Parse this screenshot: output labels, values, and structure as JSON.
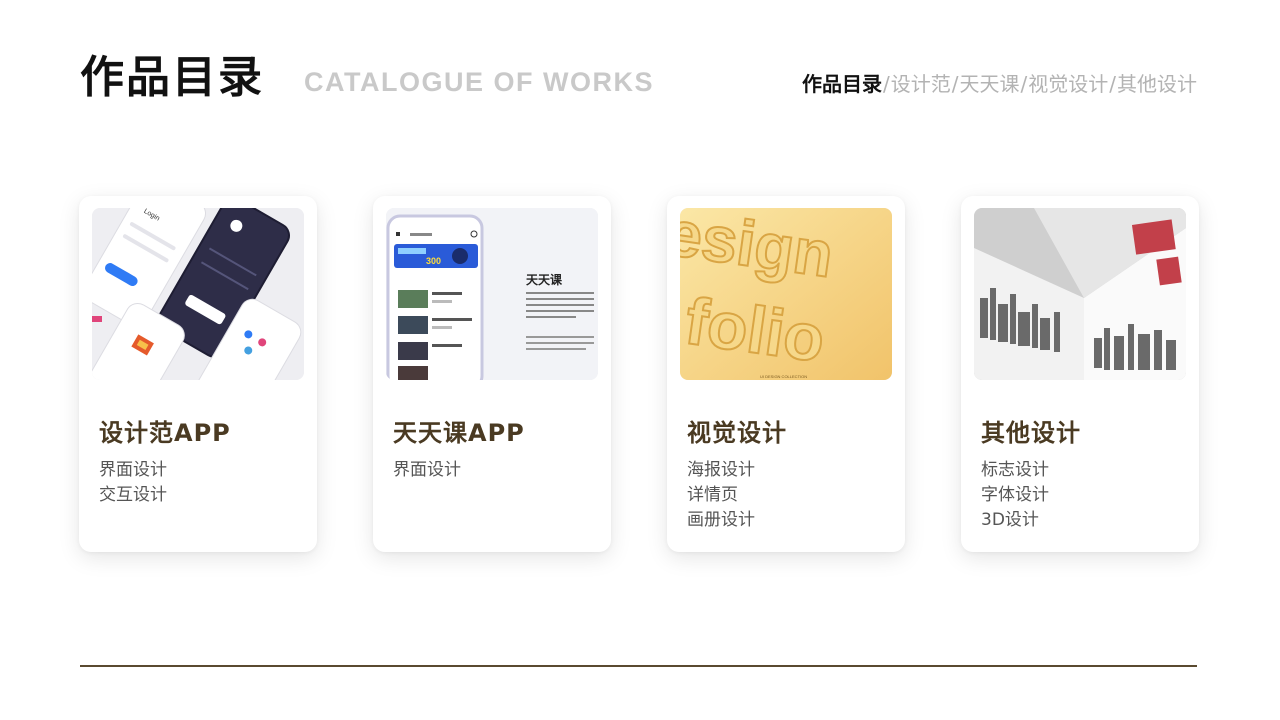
{
  "header": {
    "title": "作品目录",
    "subtitle": "CATALOGUE OF WORKS",
    "breadcrumbs": [
      "作品目录",
      "设计范",
      "天天课",
      "视觉设计",
      "其他设计"
    ]
  },
  "colors": {
    "title": "#111111",
    "subtitle": "#c9c9c9",
    "card_title": "#4a3a22",
    "rule": "#5a4a30"
  },
  "cards": [
    {
      "title": "设计范APP",
      "items": [
        "界面设计",
        "交互设计"
      ],
      "thumb_text": {
        "login": "Login"
      }
    },
    {
      "title": "天天课APP",
      "items": [
        "界面设计"
      ],
      "thumb_text": {
        "heading": "天天课",
        "promo": "300",
        "desc_en": "This project is suitable for all text, font, insert your photos The project is fully universal."
      }
    },
    {
      "title": "视觉设计",
      "items": [
        "海报设计",
        "详情页",
        "画册设计"
      ],
      "thumb_text": {
        "big1": "esign",
        "big2": "folio",
        "footer": "UI DESIGN COLLECTION"
      }
    },
    {
      "title": "其他设计",
      "items": [
        "标志设计",
        "字体设计",
        "3D设计"
      ]
    }
  ]
}
